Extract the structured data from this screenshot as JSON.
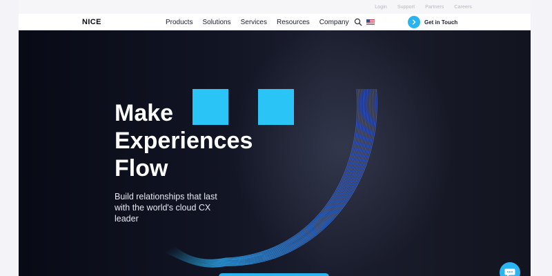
{
  "utility_nav": {
    "items": [
      "Login",
      "Support",
      "Partners",
      "Careers"
    ]
  },
  "header": {
    "logo": "NICE",
    "nav_items": [
      "Products",
      "Solutions",
      "Services",
      "Resources",
      "Company"
    ],
    "search_icon": "search-icon",
    "flag_icon": "us-flag-icon",
    "cta_label": "Get in Touch",
    "cta_icon": "chevron-right-icon"
  },
  "hero": {
    "title_lines": [
      "Make",
      "Experiences",
      "Flow"
    ],
    "subtitle": "Build relationships that last with the world's cloud CX leader",
    "accent_color": "#2bc4f7",
    "arc_color": "#3b6fe0"
  },
  "chat": {
    "icon": "chat-bubble-icon"
  },
  "colors": {
    "brand_blue": "#2bb4f0",
    "nav_text": "#1d1f2d",
    "hero_bg": "#0f1220"
  }
}
